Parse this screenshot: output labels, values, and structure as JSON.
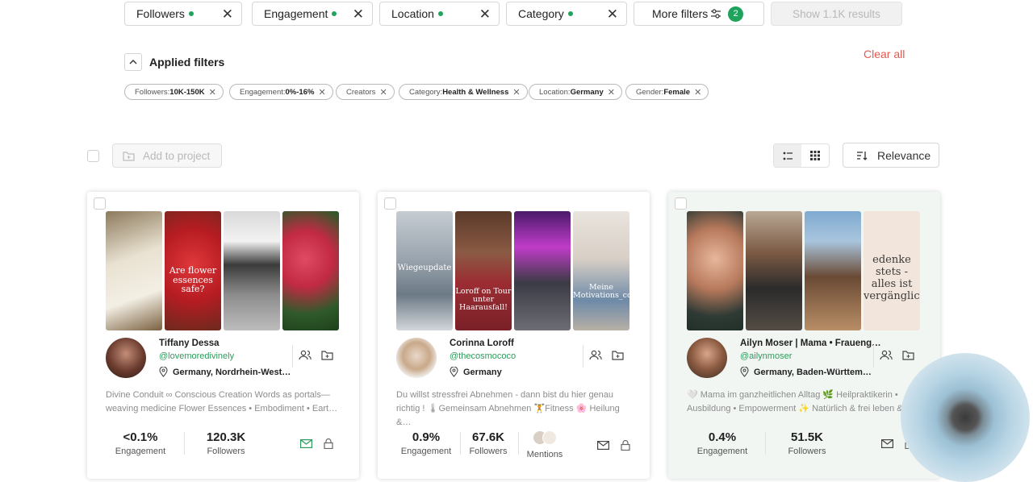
{
  "filter_bar": {
    "buttons": [
      {
        "label": "Followers"
      },
      {
        "label": "Engagement"
      },
      {
        "label": "Location"
      },
      {
        "label": "Category"
      }
    ],
    "more_filters_label": "More filters",
    "more_filters_count": "2",
    "show_results_label": "Show 1.1K results"
  },
  "applied": {
    "title": "Applied filters",
    "clear_all": "Clear all",
    "chips": [
      {
        "key": "Followers: ",
        "value": "10K-150K"
      },
      {
        "key": "Engagement: ",
        "value": "0%-16%"
      },
      {
        "key": "Creators",
        "value": ""
      },
      {
        "key": "Category: ",
        "value": "Health & Wellness"
      },
      {
        "key": "Location: ",
        "value": "Germany"
      },
      {
        "key": "Gender: ",
        "value": "Female"
      }
    ]
  },
  "toolbar": {
    "add_to_project": "Add to project",
    "sort_label": "Relevance"
  },
  "cards": [
    {
      "name": "Tiffany Dessa",
      "handle": "@lovemoredivinely",
      "location": "Germany, Nordrhein-West…",
      "bio": "Divine Conduit ∞ Conscious Creation Words as portals—weaving medicine Flower Essences • Embodiment • Eart…",
      "thumb_captions": [
        "",
        "Are flower essences safe?",
        "",
        ""
      ],
      "stats": [
        {
          "value": "<0.1%",
          "label": "Engagement"
        },
        {
          "value": "120.3K",
          "label": "Followers"
        }
      ]
    },
    {
      "name": "Corinna Loroff",
      "handle": "@thecosmococo",
      "location": "Germany",
      "bio": "Du willst stressfrei Abnehmen - dann bist du hier genau richtig ! 🌡Gemeinsam Abnehmen 🏋Fitness 🌸 Heilung &…",
      "thumb_captions": [
        "Wiegeupdate",
        "Loroff on Tour unter Haarausfall!",
        "",
        "Meine Motivations_co"
      ],
      "stats": [
        {
          "value": "0.9%",
          "label": "Engagement"
        },
        {
          "value": "67.6K",
          "label": "Followers"
        },
        {
          "value": "",
          "label": "Mentions"
        }
      ]
    },
    {
      "name": "Ailyn Moser | Mama • Fraueng…",
      "handle": "@ailynmoser",
      "location": "Germany, Baden-Württem…",
      "bio": "🤍 Mama im ganzheitlichen Alltag 🌿 Heilpraktikerin • Ausbildung • Empowerment ✨ Natürlich & frei leben &…",
      "thumb_captions": [
        "",
        "",
        "",
        "edenke stets - alles ist vergänglich!"
      ],
      "stats": [
        {
          "value": "0.4%",
          "label": "Engagement"
        },
        {
          "value": "51.5K",
          "label": "Followers"
        }
      ]
    }
  ],
  "colors": {
    "accent_green": "#1fa35c",
    "clear_all_red": "#e05a4e",
    "handle_green": "#2e9a5c"
  }
}
